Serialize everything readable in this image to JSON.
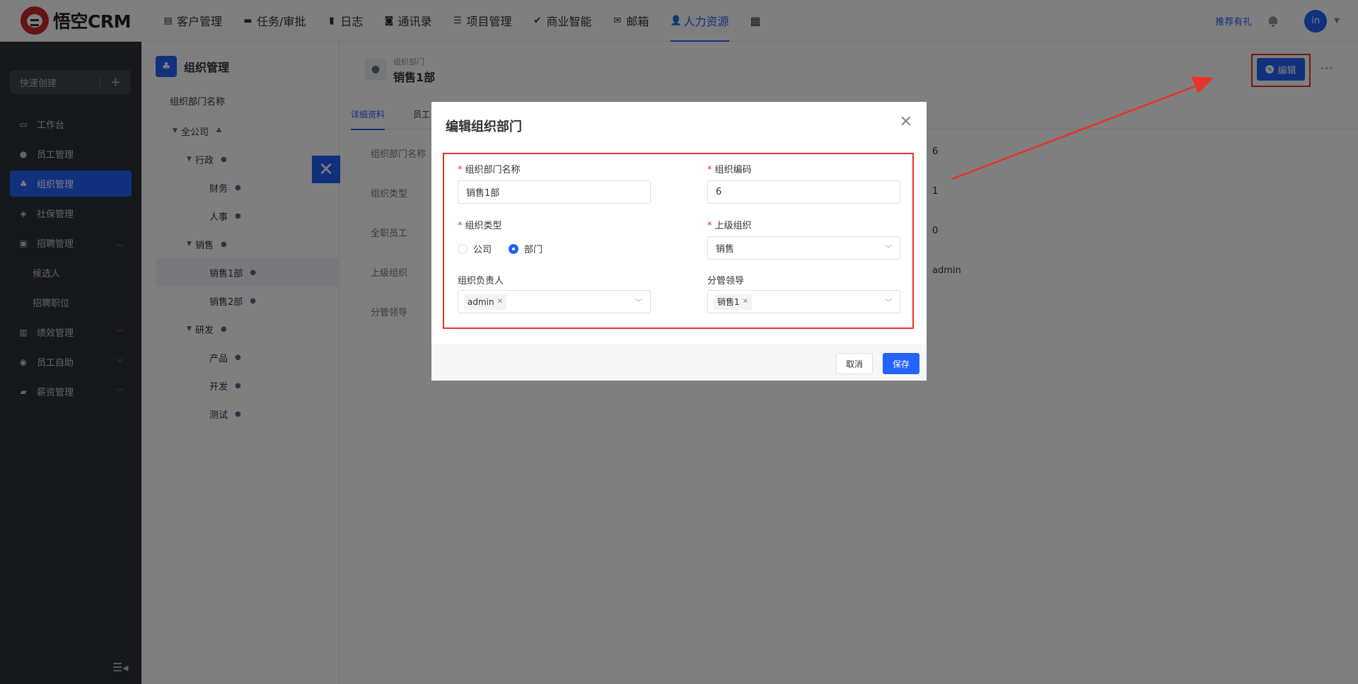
{
  "app": {
    "logo_text": "悟空CRM",
    "brand_color": "#2362fb"
  },
  "topnav": {
    "items": [
      {
        "label": "客户管理",
        "icon": "file-icon"
      },
      {
        "label": "任务/审批",
        "icon": "briefcase-icon"
      },
      {
        "label": "日志",
        "icon": "book-icon"
      },
      {
        "label": "通讯录",
        "icon": "phone-icon"
      },
      {
        "label": "项目管理",
        "icon": "list-icon"
      },
      {
        "label": "商业智能",
        "icon": "check-shield-icon"
      },
      {
        "label": "邮箱",
        "icon": "mail-icon"
      },
      {
        "label": "人力资源",
        "icon": "users-icon",
        "active": true
      }
    ],
    "recommend": "推荐有礼",
    "avatar_text": "in"
  },
  "sidebar": {
    "quick_create": "快速创建",
    "items": [
      {
        "label": "工作台",
        "icon": "monitor-icon"
      },
      {
        "label": "员工管理",
        "icon": "user-icon"
      },
      {
        "label": "组织管理",
        "icon": "org-icon",
        "active": true
      },
      {
        "label": "社保管理",
        "icon": "shield-icon"
      },
      {
        "label": "招聘管理",
        "icon": "briefcase-icon",
        "expanded": true
      }
    ],
    "recruit_sub": [
      "候选人",
      "招聘职位"
    ],
    "items_after": [
      {
        "label": "绩效管理",
        "icon": "chart-icon"
      },
      {
        "label": "员工自助",
        "icon": "person-icon"
      },
      {
        "label": "薪资管理",
        "icon": "wallet-icon"
      }
    ]
  },
  "tree": {
    "title": "组织管理",
    "column": "组织部门名称",
    "nodes": [
      {
        "label": "全公司",
        "level": 0,
        "expanded": true,
        "icon": "org-icon"
      },
      {
        "label": "行政",
        "level": 1,
        "expanded": true
      },
      {
        "label": "财务",
        "level": 2
      },
      {
        "label": "人事",
        "level": 2
      },
      {
        "label": "销售",
        "level": 1,
        "expanded": true
      },
      {
        "label": "销售1部",
        "level": 2,
        "selected": true
      },
      {
        "label": "销售2部",
        "level": 2
      },
      {
        "label": "研发",
        "level": 1,
        "expanded": true
      },
      {
        "label": "产品",
        "level": 2
      },
      {
        "label": "开发",
        "level": 2
      },
      {
        "label": "测试",
        "level": 2
      }
    ]
  },
  "detail": {
    "subtitle": "组织部门",
    "title": "销售1部",
    "edit_label": "编辑",
    "tabs": [
      "详细资料",
      "员工"
    ],
    "fields": [
      {
        "label": "组织部门名称",
        "value": "6"
      },
      {
        "label": "组织类型",
        "value": "1"
      },
      {
        "label": "全职员工",
        "value": "0"
      },
      {
        "label": "上级组织",
        "value": "admin"
      },
      {
        "label": "分管领导",
        "value": ""
      }
    ]
  },
  "modal": {
    "title": "编辑组织部门",
    "name_label": "组织部门名称",
    "name_value": "销售1部",
    "code_label": "组织编码",
    "code_value": "6",
    "type_label": "组织类型",
    "type_options": [
      "公司",
      "部门"
    ],
    "type_selected": "部门",
    "parent_label": "上级组织",
    "parent_value": "销售",
    "owner_label": "组织负责人",
    "owner_tag": "admin",
    "leader_label": "分管领导",
    "leader_tag": "销售1",
    "cancel": "取消",
    "save": "保存"
  }
}
